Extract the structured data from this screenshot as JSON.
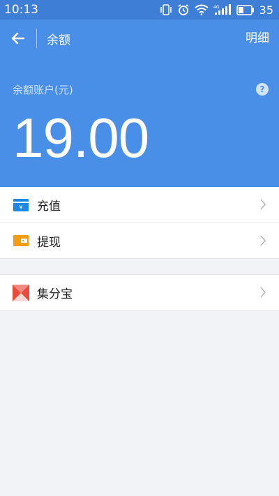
{
  "status_bar": {
    "time": "10:13",
    "battery": "35",
    "network_label": "4G"
  },
  "appbar": {
    "title": "余额",
    "detail_link": "明细"
  },
  "account": {
    "label": "余额账户(元)",
    "balance": "19.00",
    "help_symbol": "?"
  },
  "menu": {
    "group1": [
      {
        "label": "充值",
        "icon": "recharge-icon",
        "color": "#1e88e5"
      },
      {
        "label": "提现",
        "icon": "withdraw-icon",
        "color": "#f39c12"
      }
    ],
    "group2": [
      {
        "label": "集分宝",
        "icon": "jifenbao-icon",
        "color": "#e74c3c"
      }
    ]
  },
  "colors": {
    "header_blue": "#4a8fe7",
    "statusbar_blue": "#3f7ed6",
    "background": "#f2f3f7"
  }
}
